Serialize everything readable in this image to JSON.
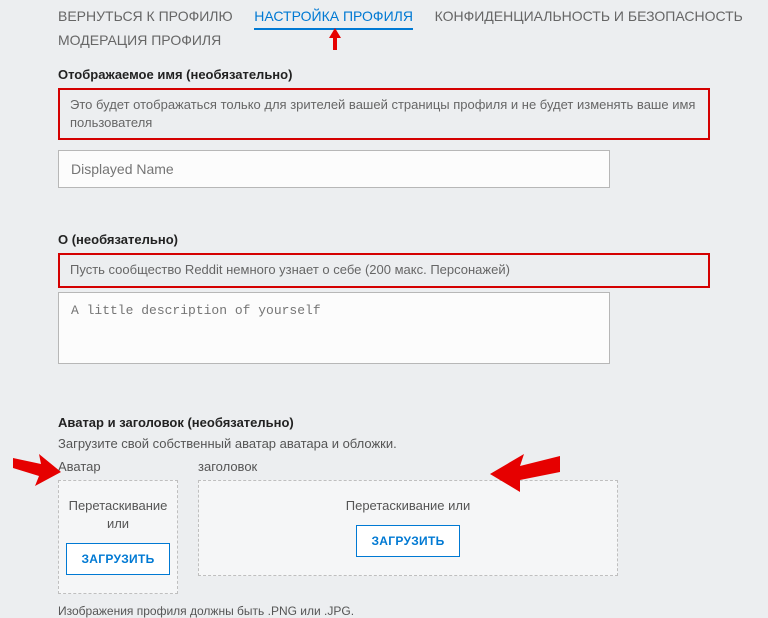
{
  "tabs": {
    "return": "ВЕРНУТЬСЯ К ПРОФИЛЮ",
    "settings": "НАСТРОЙКА ПРОФИЛЯ",
    "privacy": "КОНФИДЕНЦИАЛЬНОСТЬ И БЕЗОПАСНОСТЬ",
    "moderation": "МОДЕРАЦИЯ ПРОФИЛЯ"
  },
  "display_name": {
    "label": "Отображаемое имя (необязательно)",
    "hint": "Это будет отображаться только для зрителей вашей страницы профиля и не будет изменять ваше имя пользователя",
    "placeholder": "Displayed Name"
  },
  "about": {
    "label": "О (необязательно)",
    "hint": "Пусть сообщество Reddit немного узнает о себе (200 макс. Персонажей)",
    "placeholder": "A little description of yourself"
  },
  "avatar_section": {
    "title": "Аватар и заголовок (необязательно)",
    "subtitle": "Загрузите свой собственный аватар аватара и обложки.",
    "avatar_label": "Аватар",
    "header_label": "заголовок",
    "drag_text": "Перетаскивание или",
    "upload_btn": "ЗАГРУЗИТЬ",
    "footnote": "Изображения профиля должны быть .PNG или .JPG."
  }
}
